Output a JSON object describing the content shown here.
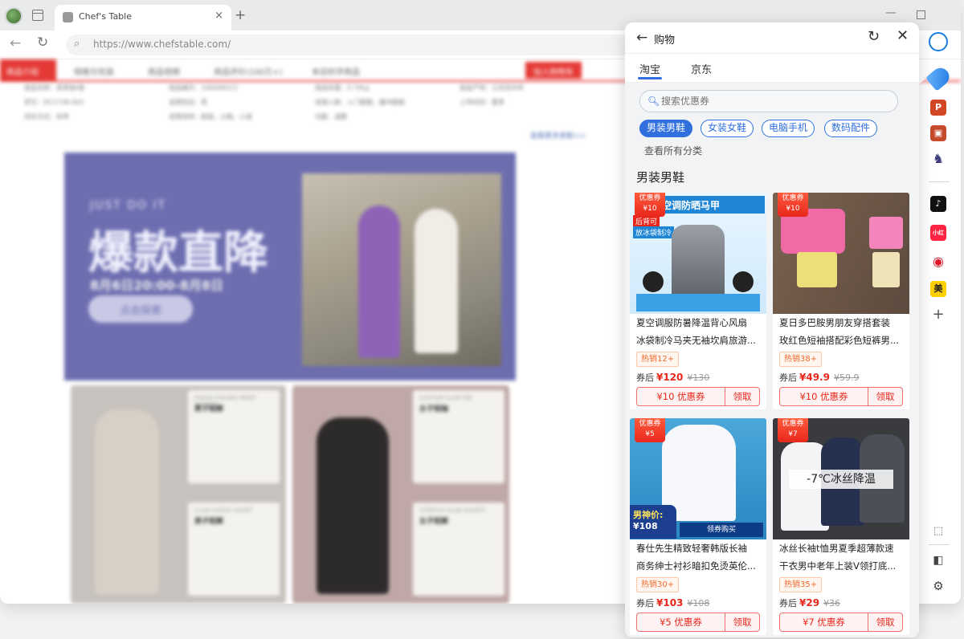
{
  "browser": {
    "tab_title": "Chef's Table",
    "address": "https://www.chefstable.com/",
    "tab_close": "×",
    "tab_new": "+"
  },
  "webpage": {
    "nav_items": [
      "商品介绍",
      "规格与包装",
      "商品视频",
      "商品评价(100万+)",
      "本店好评商品",
      "加入购物车"
    ],
    "spec_rows": [
      [
        "商品名称：某男装t恤",
        "商品编号：100006523",
        "商品毛重：0.70kg",
        "商品产地：江苏苏州市"
      ],
      [
        "货号：DC2738-403",
        "适用性别：男",
        "适用人群：入门跑鞋，缓冲跑鞋",
        "上市时间：夏季"
      ],
      [
        "闭合方式：系带",
        "适用场地：跑道，公路，小道",
        "功能：减震",
        ""
      ]
    ],
    "spec_more": "查看更多参数>>",
    "banner_sub": "JUST DO IT",
    "banner_title": "爆款直降",
    "banner_date": "8月6日20:00-8月8日",
    "banner_btn": "点击探索",
    "mini_cards": [
      {
        "en": "FRESH COLORS PRINT SHORTS",
        "cn": "男子短裤"
      },
      {
        "en": "CLUB CARGO SHORT",
        "cn": "男子短裤"
      },
      {
        "en": "CUSTOM SLUB TEE",
        "cn": "女子短袖"
      },
      {
        "en": "STRETCH SLUB SHORTS",
        "cn": "女子短裤"
      }
    ]
  },
  "panel": {
    "title": "购物",
    "tabs": [
      "淘宝",
      "京东"
    ],
    "search_placeholder": "搜索优惠券",
    "chips": [
      "男装男鞋",
      "女装女鞋",
      "电脑手机",
      "数码配件"
    ],
    "all_categories": "查看所有分类",
    "section_title": "男装男鞋",
    "products": [
      {
        "badge_label": "优惠券",
        "badge_value": "¥10",
        "title_line1": "夏空调服防暑降温背心风扇",
        "title_line2": "冰袋制冷马夹无袖坎肩旅游...",
        "sales": "热销12+",
        "price_prefix": "券后",
        "price": "¥120",
        "old_price": "¥130",
        "coupon": "¥10 优惠券",
        "claim": "领取",
        "img_text": [
          "空调防晒马甲",
          "后背可",
          "放冰袋制冷"
        ]
      },
      {
        "badge_label": "优惠券",
        "badge_value": "¥10",
        "title_line1": "夏日多巴胺男朋友穿搭套装",
        "title_line2": "玫红色短袖搭配彩色短裤男...",
        "sales": "热销38+",
        "price_prefix": "券后",
        "price": "¥49.9",
        "old_price": "¥59.9",
        "coupon": "¥10 优惠券",
        "claim": "领取",
        "img_text": []
      },
      {
        "badge_label": "优惠券",
        "badge_value": "¥5",
        "title_line1": "春仕先生精致轻奢韩版长袖",
        "title_line2": "商务绅士衬衫暗扣免烫英伦...",
        "sales": "热销30+",
        "price_prefix": "券后",
        "price": "¥103",
        "old_price": "¥108",
        "coupon": "¥5 优惠券",
        "claim": "领取",
        "img_text": [
          "男神价:",
          "¥108",
          "领券购买"
        ]
      },
      {
        "badge_label": "优惠券",
        "badge_value": "¥7",
        "title_line1": "冰丝长袖t恤男夏季超薄款速",
        "title_line2": "干衣男中老年上装V领打底...",
        "sales": "热销35+",
        "price_prefix": "券后",
        "price": "¥29",
        "old_price": "¥36",
        "coupon": "¥7 优惠券",
        "claim": "领取",
        "img_text": [
          "-7℃冰丝降温"
        ]
      }
    ]
  },
  "rail": {
    "icons": [
      "edge-copilot-icon",
      "shopping-tag-icon",
      "powerpoint-icon",
      "toolbox-icon",
      "chess-icon",
      "tiktok-icon",
      "xiaohongshu-icon",
      "weibo-icon",
      "meituan-icon",
      "add-icon",
      "screenshot-icon",
      "sidebar-toggle-icon",
      "settings-icon"
    ],
    "labels": {
      "xiaohongshu": "小红书",
      "meituan": "美",
      "add": "+"
    }
  }
}
